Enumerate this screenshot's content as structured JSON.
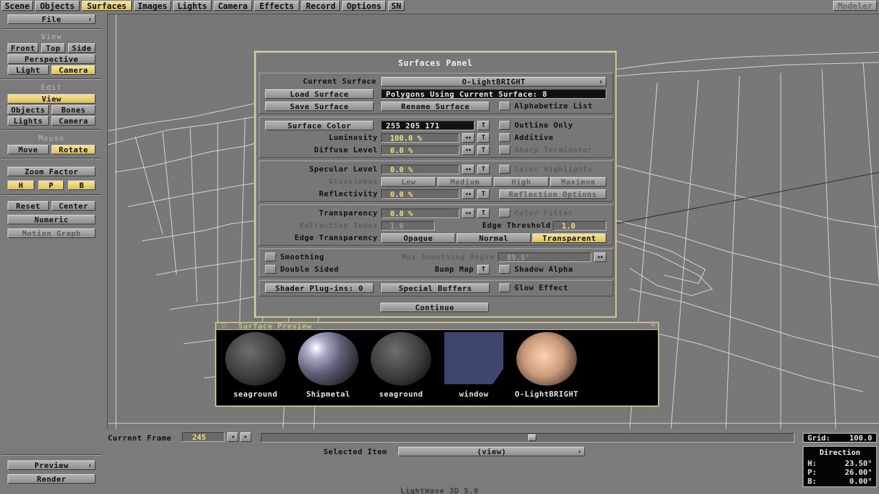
{
  "tabs": [
    "Scene",
    "Objects",
    "Surfaces",
    "Images",
    "Lights",
    "Camera",
    "Effects",
    "Record",
    "Options",
    "SN"
  ],
  "active_tab": "Surfaces",
  "modeler_label": "Modeler",
  "sidebar": {
    "file": "File",
    "view_header": "View",
    "front": "Front",
    "top": "Top",
    "side": "Side",
    "perspective": "Perspective",
    "light": "Light",
    "camera": "Camera",
    "edit_header": "Edit",
    "edit_view": "View",
    "edit_objects": "Objects",
    "edit_bones": "Bones",
    "edit_lights": "Lights",
    "edit_camera": "Camera",
    "mouse_header": "Mouse",
    "move": "Move",
    "rotate": "Rotate",
    "zoom_factor": "Zoom Factor",
    "h": "H",
    "p": "P",
    "b": "B",
    "reset": "Reset",
    "center": "Center",
    "numeric": "Numeric",
    "motion_graph": "Motion Graph",
    "preview": "Preview",
    "render": "Render"
  },
  "panel": {
    "title": "Surfaces Panel",
    "current_surface_label": "Current Surface",
    "current_surface_value": "O-LightBRIGHT",
    "load_surface": "Load Surface",
    "polygons_info": "Polygons Using Current Surface: 8",
    "save_surface": "Save Surface",
    "rename_surface": "Rename Surface",
    "alphabetize_list": "Alphabetize List",
    "surface_color": "Surface Color",
    "surface_color_value": "255  205  171",
    "t": "T",
    "outline_only": "Outline Only",
    "luminosity_label": "Luminosity",
    "luminosity_value": "100.0 %",
    "additive": "Additive",
    "diffuse_label": "Diffuse Level",
    "diffuse_value": "0.0 %",
    "sharp_terminator": "Sharp Terminator",
    "specular_label": "Specular Level",
    "specular_value": "0.0 %",
    "color_highlights": "Color Highlights",
    "glossiness_label": "Glossiness",
    "gloss_low": "Low",
    "gloss_medium": "Medium",
    "gloss_high": "High",
    "gloss_maximum": "Maximum",
    "reflectivity_label": "Reflectivity",
    "reflectivity_value": "0.0 %",
    "reflection_options": "Reflection Options",
    "transparency_label": "Transparency",
    "transparency_value": "0.0 %",
    "color_filter": "Color Filter",
    "refractive_label": "Refractive Index",
    "refractive_value": "1.0",
    "edge_threshold_label": "Edge Threshold",
    "edge_threshold_value": "1.0",
    "edge_transparency_label": "Edge Transparency",
    "edge_opaque": "Opaque",
    "edge_normal": "Normal",
    "edge_transparent": "Transparent",
    "smoothing": "Smoothing",
    "max_smoothing_label": "Max Smoothing Angle",
    "max_smoothing_value": "89.5°",
    "double_sided": "Double Sided",
    "bump_map": "Bump Map",
    "shadow_alpha": "Shadow Alpha",
    "shader_plugins": "Shader Plug-ins: 0",
    "special_buffers": "Special Buffers",
    "glow_effect": "Glow Effect",
    "continue": "Continue"
  },
  "surface_preview": {
    "title": "Surface Preview",
    "swatches": [
      "seaground",
      "Shipmetal",
      "seaground",
      "window",
      "O-LightBRIGHT"
    ]
  },
  "bottom": {
    "current_frame_label": "Current Frame",
    "current_frame_value": "245",
    "selected_item_label": "Selected Item",
    "selected_item_value": "(view)",
    "grid_label": "Grid:",
    "grid_value": "100.0",
    "direction_label": "Direction",
    "h_label": "H:",
    "h_value": "23.50°",
    "p_label": "P:",
    "p_value": "26.00°",
    "b_label": "B:",
    "b_value": "0.00°",
    "app_version": "LightWave 3D 5.0"
  },
  "colors": {
    "accent": "#e8cf6e",
    "bg": "#7b7b7b",
    "panel_border": "#d7c98e"
  }
}
